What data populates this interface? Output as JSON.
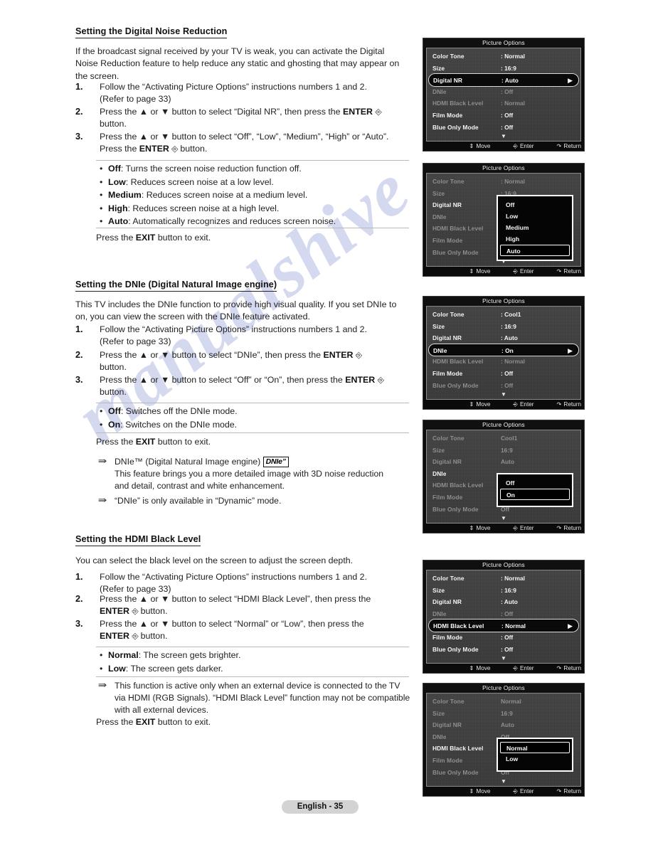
{
  "document": {
    "page_label": "English - 35",
    "watermark": "manualshive"
  },
  "sections": [
    {
      "id": "dnr",
      "title": "Setting the Digital Noise Reduction",
      "intro": "If the broadcast signal received by your TV is weak, you can activate the Digital Noise Reduction feature to help reduce any static and ghosting that may appear on the screen.",
      "steps": [
        {
          "num": "1.",
          "text_html": "Follow the &ldquo;Activating Picture Options&rdquo; instructions numbers 1 and 2.<br>(Refer to page 33)"
        },
        {
          "num": "2.",
          "text_html": "Press the &#9650; or &#9660; button to select &ldquo;Digital NR&rdquo;, then press the <b class=\"strong\">ENTER</b> <span class=\"entericon\">&#9094;</span><br>button."
        },
        {
          "num": "3.",
          "text_html": "Press the &#9650; or &#9660; button to select &ldquo;Off&rdquo;, &ldquo;Low&rdquo;, &ldquo;Medium&rdquo;, &ldquo;High&rdquo; or &ldquo;Auto&rdquo;.<br>Press the <b class=\"strong\">ENTER</b> <span class=\"entericon\">&#9094;</span> button."
        }
      ],
      "bullets": [
        {
          "term": "Off",
          "desc": ": Turns the screen noise reduction function off."
        },
        {
          "term": "Low",
          "desc": ": Reduces screen noise at a low level."
        },
        {
          "term": "Medium",
          "desc": ": Reduces screen noise at a medium level."
        },
        {
          "term": "High",
          "desc": ": Reduces screen noise at a high level."
        },
        {
          "term": "Auto",
          "desc": ": Automatically recognizes and reduces screen noise."
        }
      ],
      "exit_html": "Press the <b class=\"strong\">EXIT</b> button to exit."
    },
    {
      "id": "dnie",
      "title": "Setting the DNIe (Digital Natural Image engine)",
      "intro": "This TV includes the DNIe function to provide high visual quality. If you set DNIe to on, you can view the screen with the DNIe feature activated.",
      "steps": [
        {
          "num": "1.",
          "text_html": "Follow the &ldquo;Activating Picture Options&rdquo; instructions numbers 1 and 2.<br>(Refer to page 33)"
        },
        {
          "num": "2.",
          "text_html": "Press the &#9650; or &#9660; button to select &ldquo;DNIe&rdquo;, then press the <b class=\"strong\">ENTER</b> <span class=\"entericon\">&#9094;</span><br>button."
        },
        {
          "num": "3.",
          "text_html": "Press the &#9650; or &#9660; button to select &ldquo;Off&rdquo; or &ldquo;On&rdquo;, then press the <b class=\"strong\">ENTER</b> <span class=\"entericon\">&#9094;</span><br>button."
        }
      ],
      "bullets": [
        {
          "term": "Off",
          "desc": ": Switches off the DNIe mode."
        },
        {
          "term": "On",
          "desc": ": Switches on the DNIe mode."
        }
      ],
      "exit_html": "Press the <b class=\"strong\">EXIT</b> button to exit.",
      "notes": [
        "DNIe™ (Digital Natural Image engine) [DNIe] This feature brings you a more detailed image with 3D noise reduction and detail, contrast and white enhancement.",
        "“DNIe” is only available in “Dynamic” mode."
      ]
    },
    {
      "id": "hdmiblack",
      "title": "Setting the HDMI Black Level",
      "intro": "You can select the black level on the screen to adjust the screen depth.",
      "steps": [
        {
          "num": "1.",
          "text_html": "Follow the &ldquo;Activating Picture Options&rdquo; instructions numbers 1 and 2.<br>(Refer to page 33)"
        },
        {
          "num": "2.",
          "text_html": "Press the &#9650; or &#9660; button to select &ldquo;HDMI Black Level&rdquo;, then press the<br><b class=\"strong\">ENTER</b> <span class=\"entericon\">&#9094;</span> button."
        },
        {
          "num": "3.",
          "text_html": "Press the &#9650; or &#9660; button to select &ldquo;Normal&rdquo; or &ldquo;Low&rdquo;, then press the<br><b class=\"strong\">ENTER</b> <span class=\"entericon\">&#9094;</span> button."
        }
      ],
      "bullets": [
        {
          "term": "Normal",
          "desc": ": The screen gets brighter."
        },
        {
          "term": "Low",
          "desc": ": The screen gets darker."
        }
      ],
      "notes": [
        "This function is active only when an external device is connected to the TV via HDMI (RGB Signals). “HDMI Black Level” function may not be compatible with all external devices."
      ],
      "exit_html": "Press the <b class=\"strong\">EXIT</b> button to exit."
    }
  ],
  "osd_common": {
    "title": "Picture Options",
    "footer": {
      "move": "Move",
      "enter": "Enter",
      "return": "Return"
    },
    "labels": {
      "color_tone": "Color Tone",
      "size": "Size",
      "digital_nr": "Digital NR",
      "dnie": "DNIe",
      "hdmi_black_level": "HDMI Black Level",
      "film_mode": "Film Mode",
      "blue_only_mode": "Blue Only Mode"
    }
  },
  "osd_panels": [
    {
      "id": "panel1",
      "title": "Picture Options",
      "rows": [
        {
          "label": "Color Tone",
          "value": ": Normal",
          "state": "normal"
        },
        {
          "label": "Size",
          "value": ": 16:9",
          "state": "normal"
        },
        {
          "label": "Digital NR",
          "value": ": Auto",
          "state": "selected"
        },
        {
          "label": "DNIe",
          "value": ": Off",
          "state": "dim"
        },
        {
          "label": "HDMI Black Level",
          "value": ": Normal",
          "state": "dim"
        },
        {
          "label": "Film Mode",
          "value": ": Off",
          "state": "normal"
        },
        {
          "label": "Blue Only Mode",
          "value": ": Off",
          "state": "normal"
        }
      ],
      "popup": null
    },
    {
      "id": "panel2",
      "title": "Picture Options",
      "rows": [
        {
          "label": "Color Tone",
          "value": ": Normal",
          "state": "dim"
        },
        {
          "label": "Size",
          "value": ": 16:9",
          "state": "dim"
        },
        {
          "label": "Digital NR",
          "value": "",
          "state": "active-dim"
        },
        {
          "label": "DNIe",
          "value": "",
          "state": "dim"
        },
        {
          "label": "HDMI Black Level",
          "value": "",
          "state": "dim"
        },
        {
          "label": "Film Mode",
          "value": "",
          "state": "dim"
        },
        {
          "label": "Blue Only Mode",
          "value": "",
          "state": "dim"
        }
      ],
      "popup": {
        "options": [
          "Off",
          "Low",
          "Medium",
          "High",
          "Auto"
        ],
        "highlighted": "Auto"
      }
    },
    {
      "id": "panel3",
      "title": "Picture Options",
      "rows": [
        {
          "label": "Color Tone",
          "value": ": Cool1",
          "state": "normal"
        },
        {
          "label": "Size",
          "value": ": 16:9",
          "state": "normal"
        },
        {
          "label": "Digital NR",
          "value": ": Auto",
          "state": "normal"
        },
        {
          "label": "DNIe",
          "value": ": On",
          "state": "selected"
        },
        {
          "label": "HDMI Black Level",
          "value": ": Normal",
          "state": "dim"
        },
        {
          "label": "Film Mode",
          "value": ": Off",
          "state": "normal"
        },
        {
          "label": "Blue Only Mode",
          "value": ": Off",
          "state": "dim"
        }
      ],
      "popup": null
    },
    {
      "id": "panel4",
      "title": "Picture Options",
      "rows": [
        {
          "label": "Color Tone",
          "value": "Cool1",
          "state": "dim"
        },
        {
          "label": "Size",
          "value": "16:9",
          "state": "dim"
        },
        {
          "label": "Digital NR",
          "value": "Auto",
          "state": "dim"
        },
        {
          "label": "DNIe",
          "value": "",
          "state": "active-dim"
        },
        {
          "label": "HDMI Black Level",
          "value": "",
          "state": "dim"
        },
        {
          "label": "Film Mode",
          "value": "Off",
          "state": "dim"
        },
        {
          "label": "Blue Only Mode",
          "value": "Off",
          "state": "dim"
        }
      ],
      "popup": {
        "options": [
          "Off",
          "On"
        ],
        "highlighted": "On"
      }
    },
    {
      "id": "panel5",
      "title": "Picture Options",
      "rows": [
        {
          "label": "Color Tone",
          "value": ": Normal",
          "state": "normal"
        },
        {
          "label": "Size",
          "value": ": 16:9",
          "state": "normal"
        },
        {
          "label": "Digital NR",
          "value": ": Auto",
          "state": "normal"
        },
        {
          "label": "DNIe",
          "value": ": Off",
          "state": "dim"
        },
        {
          "label": "HDMI Black Level",
          "value": ": Normal",
          "state": "selected"
        },
        {
          "label": "Film Mode",
          "value": ": Off",
          "state": "normal"
        },
        {
          "label": "Blue Only Mode",
          "value": ": Off",
          "state": "normal"
        }
      ],
      "popup": null
    },
    {
      "id": "panel6",
      "title": "Picture Options",
      "rows": [
        {
          "label": "Color Tone",
          "value": "Normal",
          "state": "dim"
        },
        {
          "label": "Size",
          "value": "16:9",
          "state": "dim"
        },
        {
          "label": "Digital NR",
          "value": "Auto",
          "state": "dim"
        },
        {
          "label": "DNIe",
          "value": "Off",
          "state": "dim"
        },
        {
          "label": "HDMI Black Level",
          "value": "",
          "state": "active-dim"
        },
        {
          "label": "Film Mode",
          "value": "",
          "state": "dim"
        },
        {
          "label": "Blue Only Mode",
          "value": "Off",
          "state": "dim"
        }
      ],
      "popup": {
        "options": [
          "Normal",
          "Low"
        ],
        "highlighted": "Normal"
      }
    }
  ]
}
